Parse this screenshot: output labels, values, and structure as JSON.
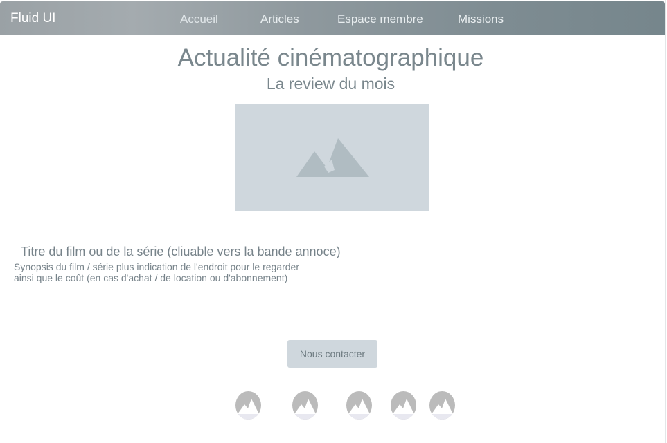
{
  "navbar": {
    "brand": "Fluid UI",
    "links": [
      {
        "label": "Accueil"
      },
      {
        "label": "Articles"
      },
      {
        "label": "Espace membre"
      },
      {
        "label": "Missions"
      }
    ]
  },
  "main": {
    "title": "Actualité cinématographique",
    "subtitle": "La review du mois",
    "hero_image_icon": "image-placeholder-icon",
    "film_title": "Titre du film ou de la série (cliuable vers la bande annoce)",
    "synopsis_lines": [
      "Synopsis du film / série plus indication de l'endroit pour le regarder",
      "ainsi que le coût (en cas d'achat / de location ou d'abonnement)"
    ],
    "contact_button": "Nous contacter"
  },
  "social": {
    "icon": "image-placeholder-icon",
    "count": 5
  },
  "colors": {
    "text": "#7a878d",
    "placeholder_bg": "#cfd7dd",
    "placeholder_mark": "#b0bcc2",
    "social_bg": "#bbbbbb",
    "social_mark": "#ffffff"
  }
}
